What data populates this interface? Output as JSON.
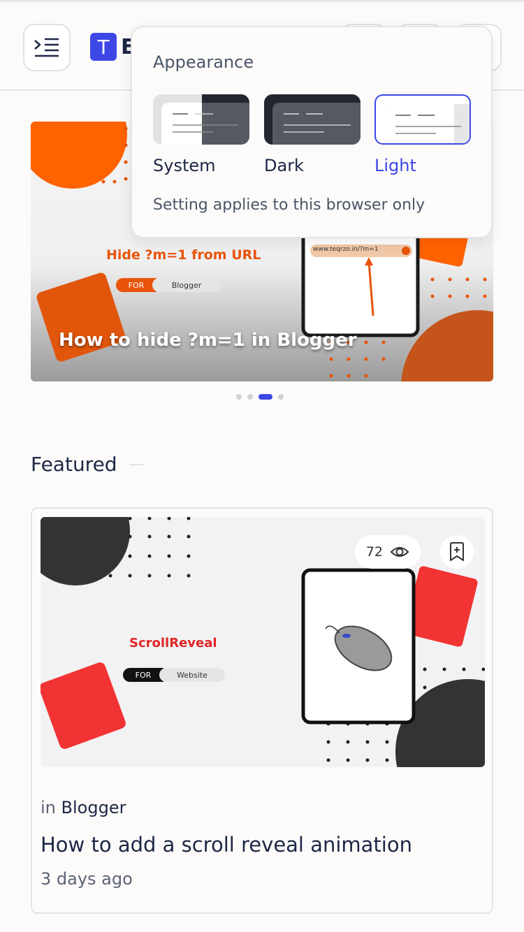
{
  "header": {
    "logo_letter": "T",
    "logo_text": "E"
  },
  "slider": {
    "title": "How to hide ?m=1 in Blogger",
    "thumb_heading": "Hide ?m=1 from URL",
    "thumb_pill_left": "FOR",
    "thumb_pill_right": "Blogger",
    "thumb_url": "www.teqrzo.in/?m=1",
    "active_slide": 3,
    "slide_count": 4
  },
  "featured": {
    "section_title": "Featured",
    "card": {
      "views": "72",
      "category_prefix": "in",
      "category": "Blogger",
      "title": "How to add a scroll reveal animation",
      "date": "3 days ago",
      "thumb_heading": "ScrollReveal",
      "thumb_pill_left": "FOR",
      "thumb_pill_right": "Website"
    }
  },
  "appearance_popup": {
    "title": "Appearance",
    "options": [
      {
        "label": "System"
      },
      {
        "label": "Dark"
      },
      {
        "label": "Light"
      }
    ],
    "selected": "Light",
    "note": "Setting applies to this browser only"
  },
  "colors": {
    "accent": "#3c47e6",
    "orange": "#e8540a",
    "red": "#f23333",
    "text": "#1d2745"
  },
  "icons": [
    "menu-indent-icon",
    "eye-icon",
    "bookmark-add-icon"
  ]
}
